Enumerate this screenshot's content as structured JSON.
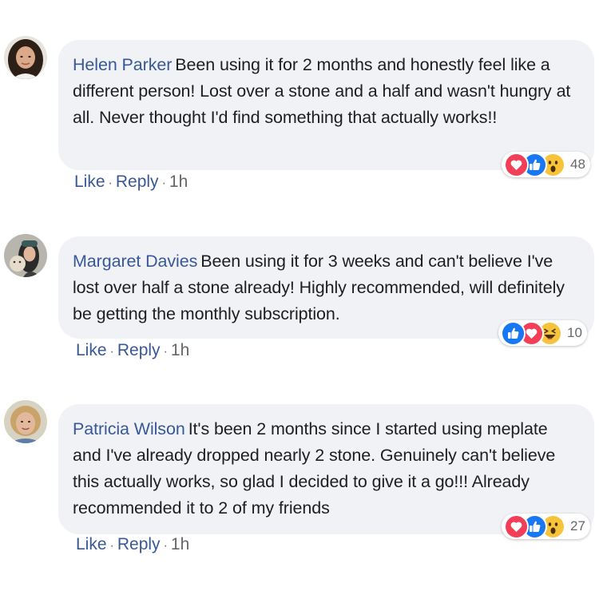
{
  "comments": [
    {
      "author": "Helen Parker",
      "text": "Been using it for 2 months and honestly feel like a different person! Lost over a stone and a half and wasn't hungry at all. Never thought I'd find something that actually works!!",
      "reactions": [
        "love",
        "like",
        "wow"
      ],
      "reaction_count": "48",
      "like_label": "Like",
      "reply_label": "Reply",
      "separator": "·",
      "time": "1h"
    },
    {
      "author": "Margaret Davies",
      "text": "Been using it for 3 weeks and can't believe I've lost over half a stone already! Highly recommended, will definitely be getting the monthly subscription.",
      "reactions": [
        "like",
        "love",
        "haha"
      ],
      "reaction_count": "10",
      "like_label": "Like",
      "reply_label": "Reply",
      "separator": "·",
      "time": "1h"
    },
    {
      "author": "Patricia Wilson",
      "text": "It's been 2 months since I started using meplate and I've already dropped nearly 2 stone. Genuinely can't believe this actually works, so glad I decided to give it a go!!! Already recommended it to 2 of my friends",
      "reactions": [
        "love",
        "like",
        "wow"
      ],
      "reaction_count": "27",
      "like_label": "Like",
      "reply_label": "Reply",
      "separator": "·",
      "time": "1h"
    }
  ],
  "colors": {
    "author": "#385898",
    "bubble": "#f0f2f5",
    "text": "#1c1e21",
    "meta": "#65676b"
  }
}
